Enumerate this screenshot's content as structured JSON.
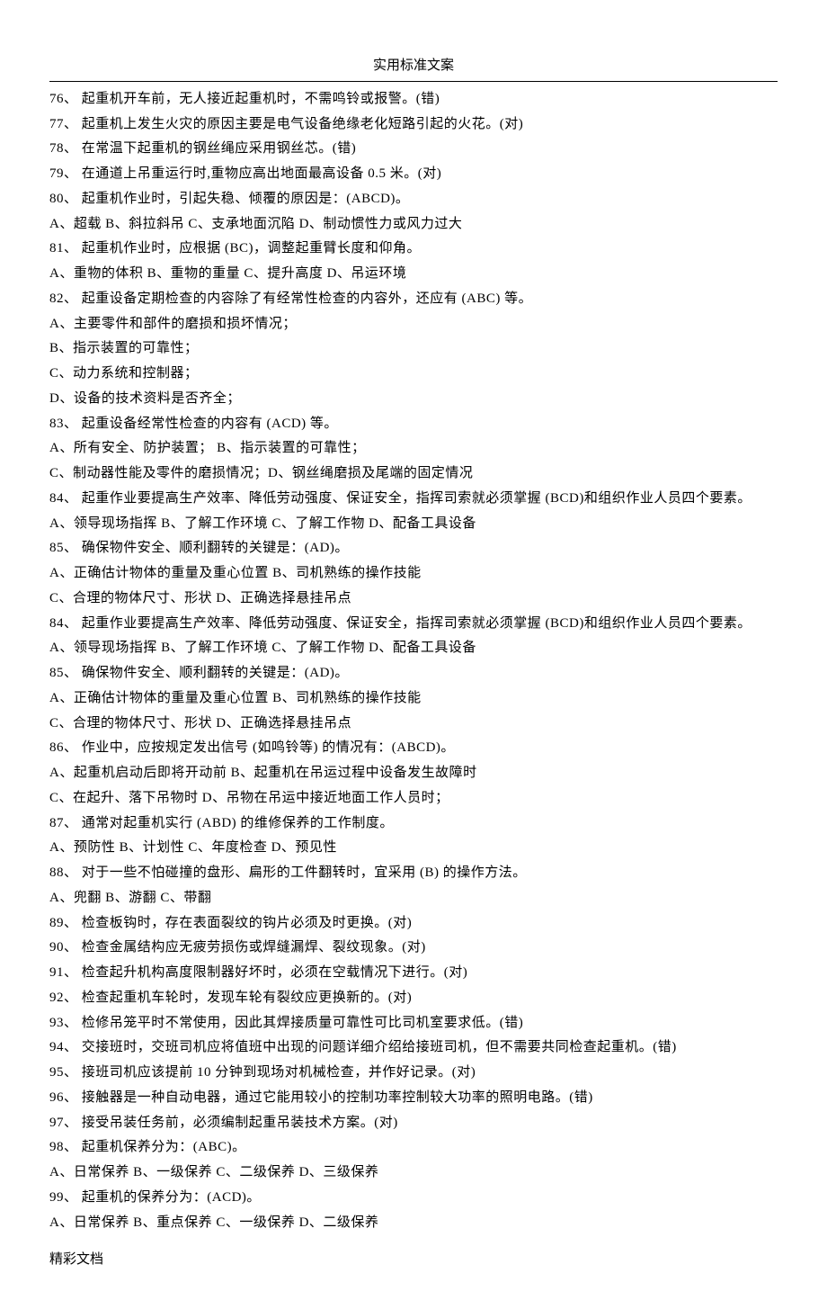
{
  "header": "实用标准文案",
  "footer": "精彩文档",
  "lines": [
    "76、 起重机开车前，无人接近起重机时，不需鸣铃或报警。(错)",
    "77、 起重机上发生火灾的原因主要是电气设备绝缘老化短路引起的火花。(对)",
    "78、 在常温下起重机的钢丝绳应采用钢丝芯。(错)",
    "79、 在通道上吊重运行时,重物应高出地面最高设备 0.5 米。(对)",
    "80、 起重机作业时，引起失稳、倾覆的原因是：(ABCD)。",
    "A、超载 B、斜拉斜吊 C、支承地面沉陷 D、制动惯性力或风力过大",
    "81、 起重机作业时，应根据 (BC)，调整起重臂长度和仰角。",
    "A、重物的体积 B、重物的重量 C、提升高度 D、吊运环境",
    "82、 起重设备定期检查的内容除了有经常性检查的内容外，还应有 (ABC) 等。",
    "A、主要零件和部件的磨损和损坏情况；",
    "B、指示装置的可靠性；",
    "C、动力系统和控制器；",
    "D、设备的技术资料是否齐全；",
    "83、 起重设备经常性检查的内容有 (ACD)  等。",
    "A、所有安全、防护装置； B、指示装置的可靠性；",
    "C、制动器性能及零件的磨损情况；D、钢丝绳磨损及尾端的固定情况",
    "84、 起重作业要提高生产效率、降低劳动强度、保证安全，指挥司索就必须掌握 (BCD)和组织作业人员四个要素。",
    "A、领导现场指挥 B、了解工作环境 C、了解工作物 D、配备工具设备",
    "85、 确保物件安全、顺利翻转的关键是：(AD)。",
    "A、正确估计物体的重量及重心位置 B、司机熟练的操作技能",
    "C、合理的物体尺寸、形状 D、正确选择悬挂吊点",
    "84、 起重作业要提高生产效率、降低劳动强度、保证安全，指挥司索就必须掌握 (BCD)和组织作业人员四个要素。",
    "A、领导现场指挥 B、了解工作环境 C、了解工作物 D、配备工具设备",
    "85、 确保物件安全、顺利翻转的关键是：(AD)。",
    "A、正确估计物体的重量及重心位置 B、司机熟练的操作技能",
    "C、合理的物体尺寸、形状 D、正确选择悬挂吊点",
    "86、 作业中，应按规定发出信号 (如鸣铃等) 的情况有：(ABCD)。",
    "A、起重机启动后即将开动前 B、起重机在吊运过程中设备发生故障时",
    "C、在起升、落下吊物时 D、吊物在吊运中接近地面工作人员时；",
    "87、 通常对起重机实行 (ABD) 的维修保养的工作制度。",
    "A、预防性 B、计划性 C、年度检查 D、预见性",
    "88、 对于一些不怕碰撞的盘形、扁形的工件翻转时，宜采用 (B) 的操作方法。",
    "A、兜翻 B、游翻 C、带翻",
    "89、 检查板钩时，存在表面裂纹的钩片必须及时更换。(对)",
    "90、 检查金属结构应无疲劳损伤或焊缝漏焊、裂纹现象。(对)",
    "91、 检查起升机构高度限制器好坏时，必须在空载情况下进行。(对)",
    "92、 检查起重机车轮时，发现车轮有裂纹应更换新的。(对)",
    "93、 检修吊笼平时不常使用，因此其焊接质量可靠性可比司机室要求低。(错)",
    "94、 交接班时，交班司机应将值班中出现的问题详细介绍给接班司机，但不需要共同检查起重机。(错)",
    "95、 接班司机应该提前 10 分钟到现场对机械检查，并作好记录。(对)",
    "96、 接触器是一种自动电器，通过它能用较小的控制功率控制较大功率的照明电路。(错)",
    "97、 接受吊装任务前，必须编制起重吊装技术方案。(对)",
    "98、 起重机保养分为：(ABC)。",
    "A、日常保养 B、一级保养 C、二级保养 D、三级保养",
    "99、 起重机的保养分为：(ACD)。",
    "A、日常保养 B、重点保养 C、一级保养 D、二级保养"
  ]
}
